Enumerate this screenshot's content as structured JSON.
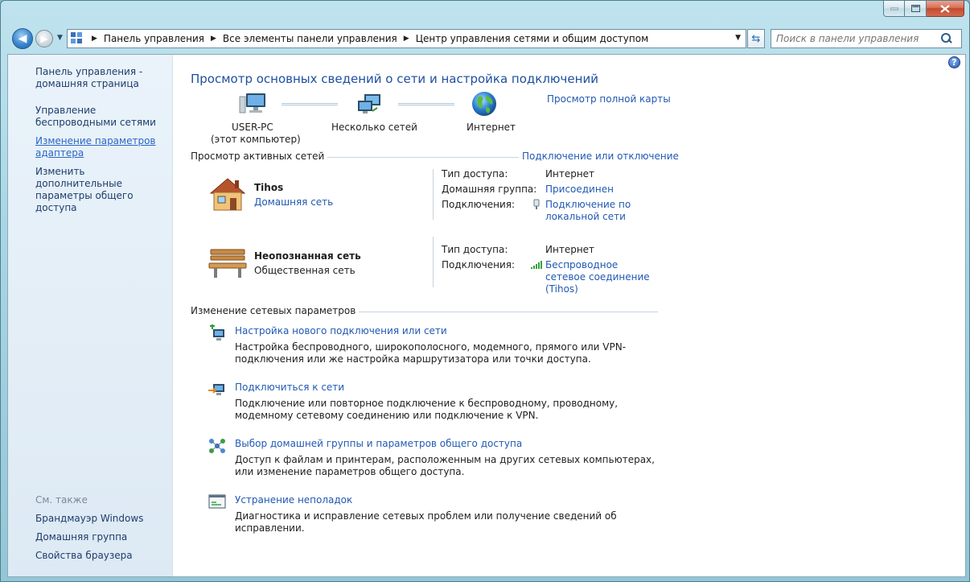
{
  "window": {
    "controls": [
      "minimize",
      "maximize",
      "close"
    ]
  },
  "address_bar": {
    "crumbs": [
      "Панель управления",
      "Все элементы панели управления",
      "Центр управления сетями и общим доступом"
    ]
  },
  "search": {
    "placeholder": "Поиск в панели управления"
  },
  "sidebar": {
    "home": "Панель управления - домашняя страница",
    "links": [
      "Управление беспроводными сетями",
      "Изменение параметров адаптера",
      "Изменить дополнительные параметры общего доступа"
    ],
    "see_also_heading": "См. также",
    "see_also": [
      "Брандмауэр Windows",
      "Домашняя группа",
      "Свойства браузера"
    ]
  },
  "main": {
    "title": "Просмотр основных сведений о сети и настройка подключений",
    "full_map_link": "Просмотр полной карты",
    "map": {
      "computer_name": "USER-PC",
      "computer_note": "(этот компьютер)",
      "networks": "Несколько сетей",
      "internet": "Интернет"
    },
    "active_heading": "Просмотр активных сетей",
    "connect_link": "Подключение или отключение",
    "networks": [
      {
        "name": "Tihos",
        "type": "Домашняя сеть",
        "access_label": "Тип доступа:",
        "access_value": "Интернет",
        "homegroup_label": "Домашняя группа:",
        "homegroup_value": "Присоединен",
        "connections_label": "Подключения:",
        "connection_value": "Подключение по локальной сети"
      },
      {
        "name": "Неопознанная сеть",
        "type": "Общественная сеть",
        "access_label": "Тип доступа:",
        "access_value": "Интернет",
        "connections_label": "Подключения:",
        "connection_value": "Беспроводное сетевое соединение (Tihos)"
      }
    ],
    "change_heading": "Изменение сетевых параметров",
    "tasks": [
      {
        "title": "Настройка нового подключения или сети",
        "desc": "Настройка беспроводного, широкополосного, модемного, прямого или VPN-подключения или же настройка маршрутизатора или точки доступа."
      },
      {
        "title": "Подключиться к сети",
        "desc": "Подключение или повторное подключение к беспроводному, проводному, модемному сетевому соединению или подключение к VPN."
      },
      {
        "title": "Выбор домашней группы и параметров общего доступа",
        "desc": "Доступ к файлам и принтерам, расположенным на других сетевых компьютерах, или изменение параметров общего доступа."
      },
      {
        "title": "Устранение неполадок",
        "desc": "Диагностика и исправление сетевых проблем или получение сведений об исправлении."
      }
    ]
  }
}
